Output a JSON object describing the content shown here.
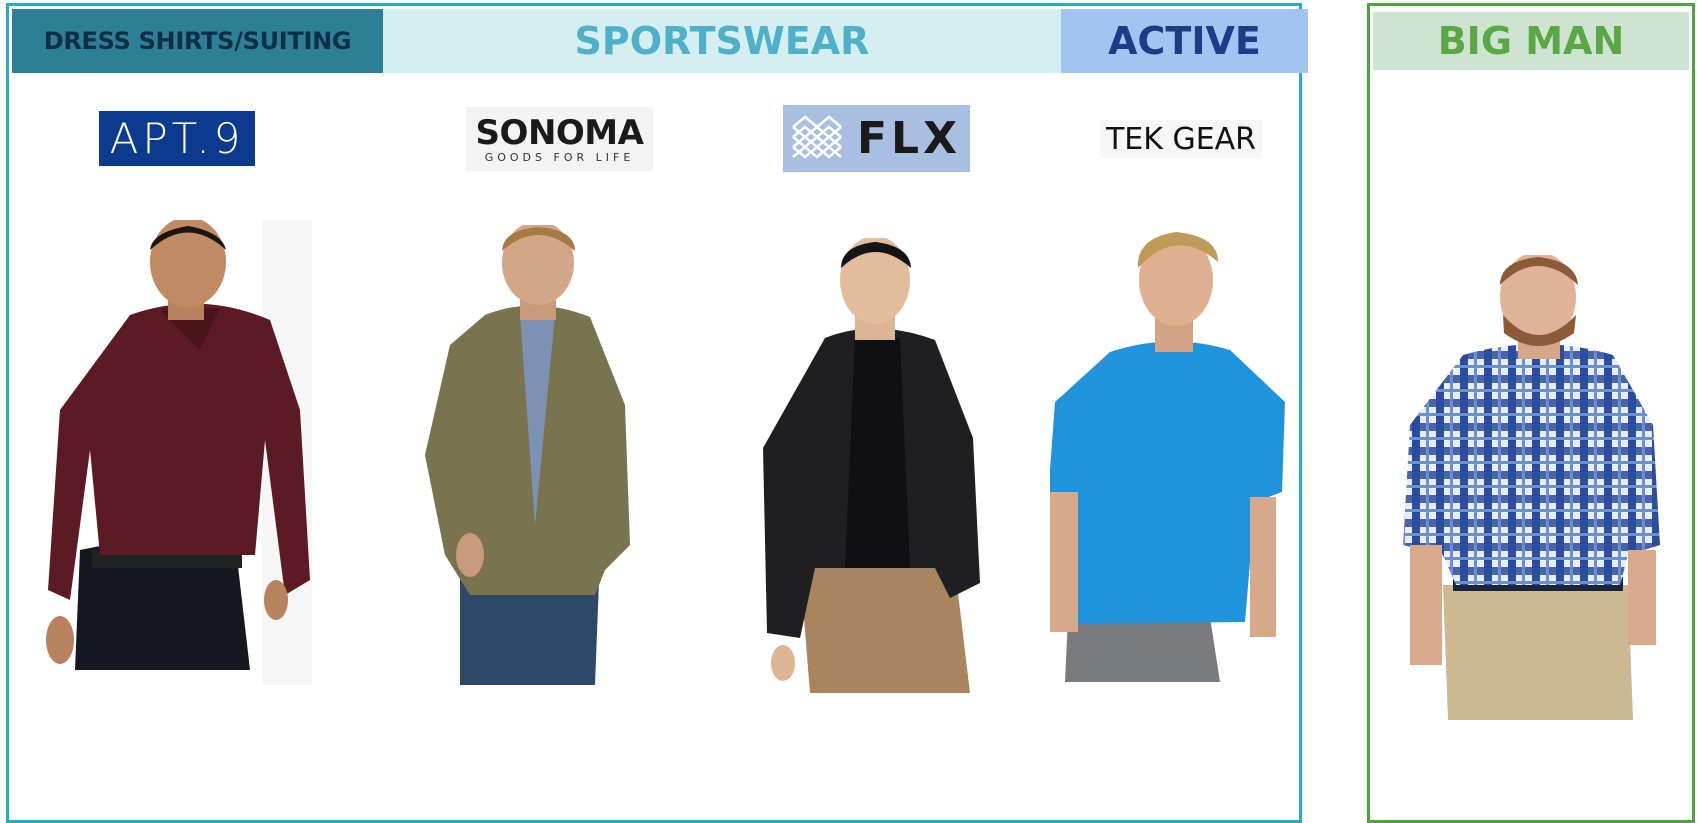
{
  "headers": {
    "dress": "DRESS SHIRTS/SUITING",
    "sportswear": "SPORTSWEAR",
    "active": "ACTIVE",
    "big_man": "BIG MAN"
  },
  "brands": {
    "apt9": "APT.9",
    "sonoma": "SONOMA",
    "sonoma_tagline": "GOODS FOR LIFE",
    "flx": "FLX",
    "tek_gear": "TEK GEAR"
  },
  "colors": {
    "main_border": "#1fb0c4",
    "big_border": "#4aa83a",
    "apt9_bg": "#0b3a8f",
    "flx_bg": "#a9bfe2"
  },
  "models": [
    "burgundy-dress-shirt-model",
    "olive-shirt-jacket-model",
    "black-bomber-model",
    "blue-tee-model",
    "plaid-shirt-model"
  ]
}
